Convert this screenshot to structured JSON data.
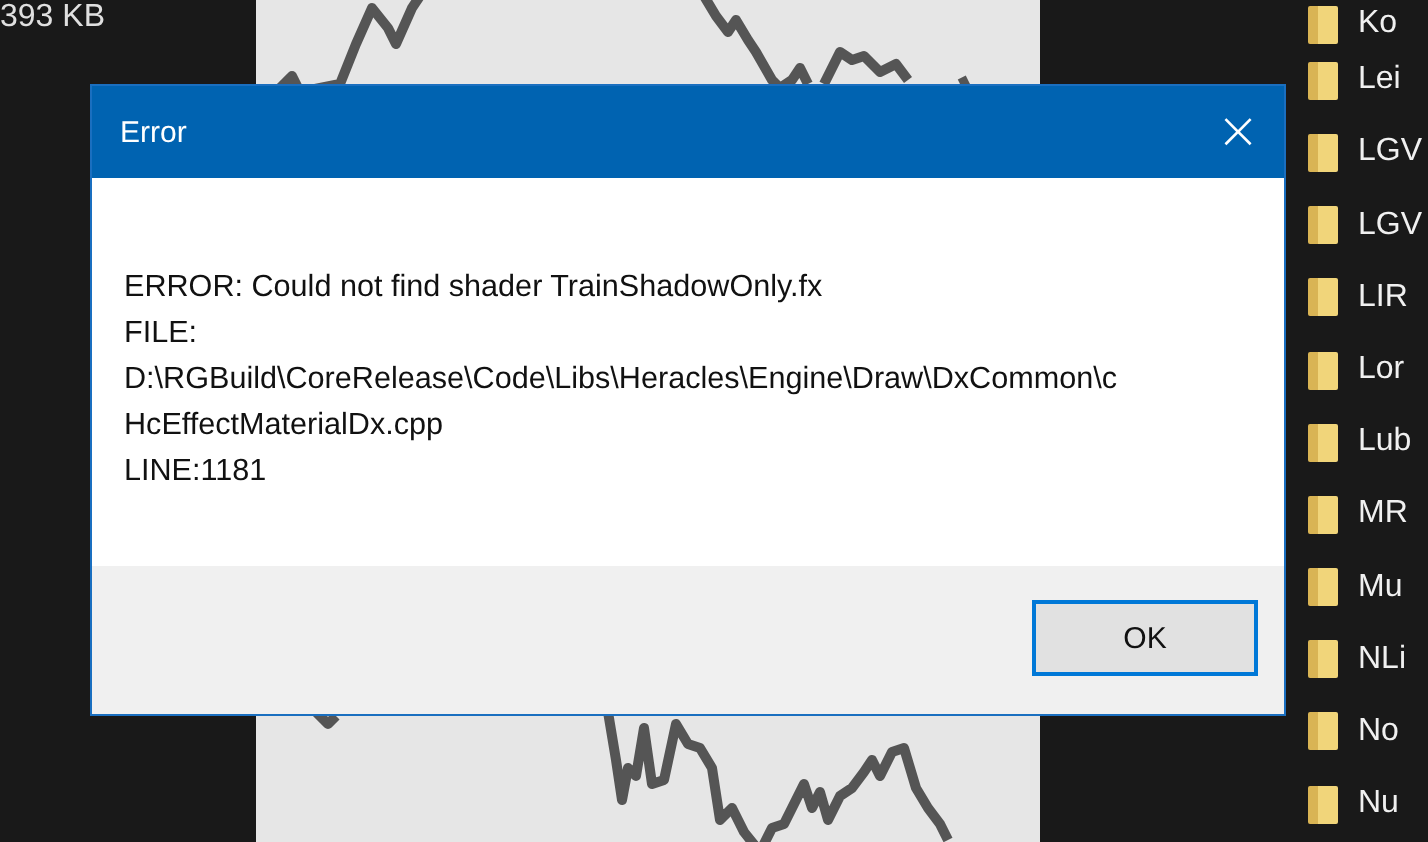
{
  "background": {
    "file_size": "393 KB",
    "folders": [
      "Ko",
      "Lei",
      "LGV",
      "LGV",
      "LIR",
      "Lor",
      "Lub",
      "MR",
      "Mu",
      "NLi",
      "No",
      "Nu"
    ]
  },
  "dialog": {
    "title": "Error",
    "close": "×",
    "message": "ERROR: Could not find shader TrainShadowOnly.fx\nFILE:\nD:\\RGBuild\\CoreRelease\\Code\\Libs\\Heracles\\Engine\\Draw\\DxCommon\\c\nHcEffectMaterialDx.cpp\nLINE:1181",
    "buttons": [
      "OK"
    ]
  }
}
